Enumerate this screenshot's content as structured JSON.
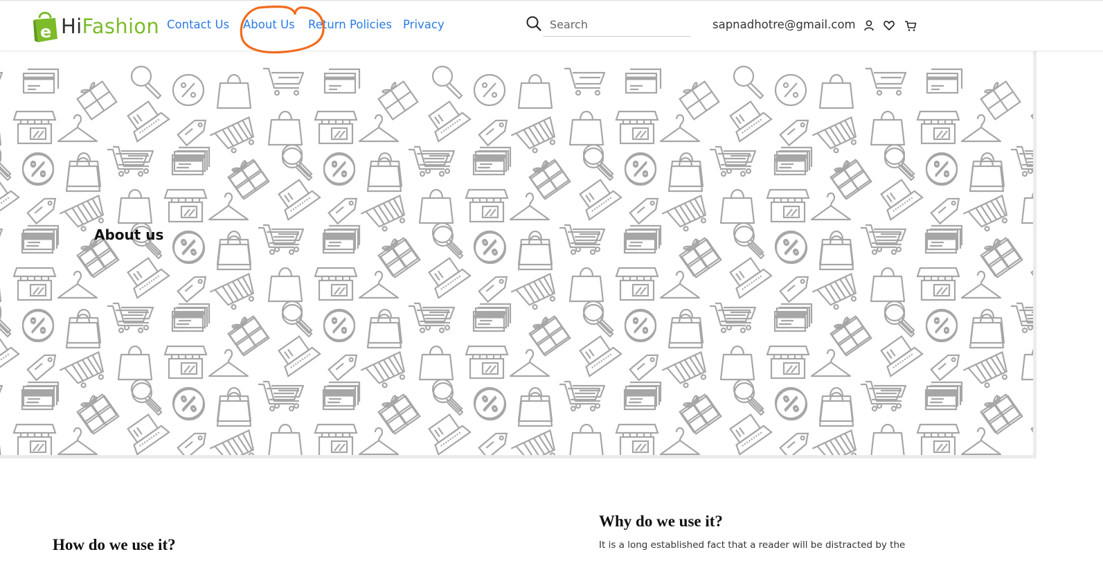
{
  "brand": {
    "logo_letter": "e",
    "name_part1": "Hi",
    "name_part2": "Fashion",
    "accent_color": "#7dbb2a"
  },
  "nav": {
    "link_color": "#2a7be4",
    "items": [
      {
        "label": "Contact Us"
      },
      {
        "label": "About Us",
        "highlighted": true
      },
      {
        "label": "Return Policies"
      },
      {
        "label": "Privacy"
      }
    ]
  },
  "annotation": {
    "shape": "hand-drawn circle",
    "color": "#f26b1d"
  },
  "search": {
    "placeholder": "Search",
    "value": ""
  },
  "account": {
    "email": "sapnadhotre@gmail.com"
  },
  "header_icons": [
    "user-icon",
    "heart-icon",
    "cart-icon"
  ],
  "banner": {
    "title": "About us",
    "pattern": "shopping icons pattern"
  },
  "sections": [
    {
      "title": "How do we use it?"
    },
    {
      "title": "Why do we use it?",
      "text": "It is a long established fact that a reader will be distracted by the"
    }
  ]
}
